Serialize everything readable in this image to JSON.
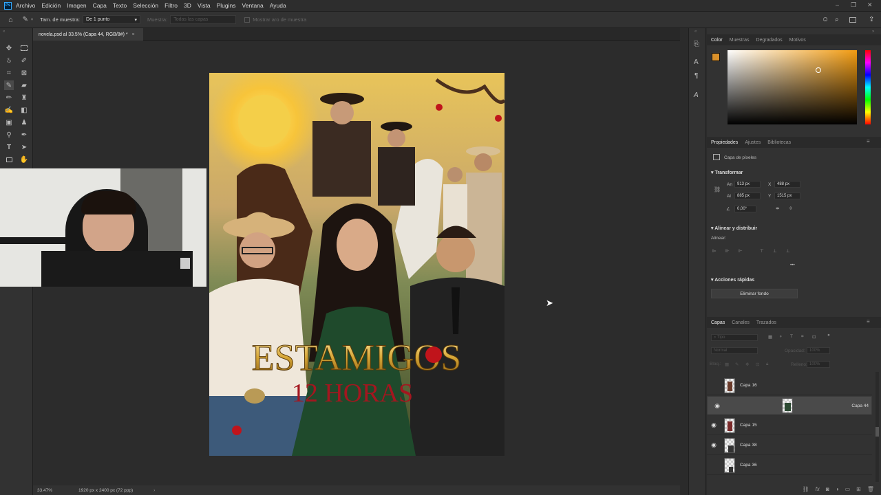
{
  "menubar": {
    "items": [
      "Archivo",
      "Edición",
      "Imagen",
      "Capa",
      "Texto",
      "Selección",
      "Filtro",
      "3D",
      "Vista",
      "Plugins",
      "Ventana",
      "Ayuda"
    ]
  },
  "options_bar": {
    "sample_size_label": "Tam. de muestra:",
    "sample_size_value": "De 1 punto",
    "sample_label": "Muestra:",
    "sample_value": "Todas las capas",
    "show_ring_label": "Mostrar aro de muestra"
  },
  "document": {
    "tab_title": "novela.psd al 33.5% (Capa 44, RGB/8#) *",
    "zoom": "33.47%",
    "doc_info": "1920 px x 2400 px (72 ppp)"
  },
  "poster": {
    "title": "ESTAMIGOS",
    "subtitle": "12 HORAS"
  },
  "color_panel": {
    "tabs": [
      "Color",
      "Muestras",
      "Degradados",
      "Motivos"
    ],
    "foreground": "#d9902a"
  },
  "properties_panel": {
    "tabs": [
      "Propiedades",
      "Ajustes",
      "Bibliotecas"
    ],
    "layer_type": "Capa de píxeles",
    "transform_title": "Transformar",
    "w_label": "An",
    "w_value": "913 px",
    "x_label": "X",
    "x_value": "488 px",
    "h_label": "Al",
    "h_value": "885 px",
    "y_label": "Y",
    "y_value": "1515 px",
    "angle_value": "0,00°",
    "align_title": "Alinear y distribuir",
    "align_label": "Alinear:",
    "quick_actions_title": "Acciones rápidas",
    "remove_bg_label": "Eliminar fondo"
  },
  "layers_panel": {
    "tabs": [
      "Capas",
      "Canales",
      "Trazados"
    ],
    "filter_placeholder": "Tipo",
    "blend_mode": "Normal",
    "opacity_label": "Opacidad:",
    "opacity_value": "100%",
    "lock_label": "Bloq.:",
    "fill_label": "Relleno:",
    "fill_value": "100%",
    "layers": [
      {
        "name": "Capa 16",
        "visible": false,
        "selected": false
      },
      {
        "name": "Capa 44",
        "visible": true,
        "selected": true
      },
      {
        "name": "Capa 15",
        "visible": true,
        "selected": false
      },
      {
        "name": "Capa 38",
        "visible": true,
        "selected": false
      },
      {
        "name": "Capa 36",
        "visible": false,
        "selected": false
      }
    ]
  }
}
